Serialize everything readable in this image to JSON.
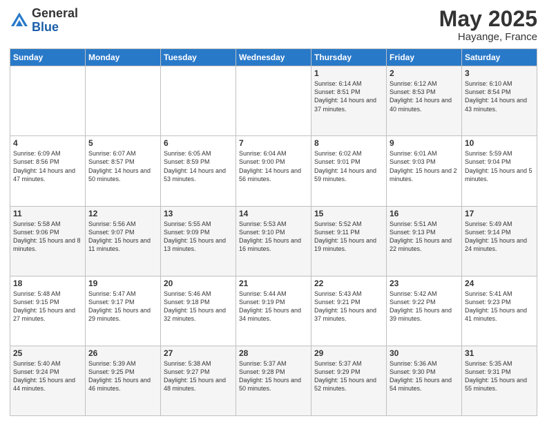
{
  "header": {
    "logo_general": "General",
    "logo_blue": "Blue",
    "month": "May 2025",
    "location": "Hayange, France"
  },
  "weekdays": [
    "Sunday",
    "Monday",
    "Tuesday",
    "Wednesday",
    "Thursday",
    "Friday",
    "Saturday"
  ],
  "weeks": [
    [
      {
        "day": "",
        "sunrise": "",
        "sunset": "",
        "daylight": ""
      },
      {
        "day": "",
        "sunrise": "",
        "sunset": "",
        "daylight": ""
      },
      {
        "day": "",
        "sunrise": "",
        "sunset": "",
        "daylight": ""
      },
      {
        "day": "",
        "sunrise": "",
        "sunset": "",
        "daylight": ""
      },
      {
        "day": "1",
        "sunrise": "Sunrise: 6:14 AM",
        "sunset": "Sunset: 8:51 PM",
        "daylight": "Daylight: 14 hours and 37 minutes."
      },
      {
        "day": "2",
        "sunrise": "Sunrise: 6:12 AM",
        "sunset": "Sunset: 8:53 PM",
        "daylight": "Daylight: 14 hours and 40 minutes."
      },
      {
        "day": "3",
        "sunrise": "Sunrise: 6:10 AM",
        "sunset": "Sunset: 8:54 PM",
        "daylight": "Daylight: 14 hours and 43 minutes."
      }
    ],
    [
      {
        "day": "4",
        "sunrise": "Sunrise: 6:09 AM",
        "sunset": "Sunset: 8:56 PM",
        "daylight": "Daylight: 14 hours and 47 minutes."
      },
      {
        "day": "5",
        "sunrise": "Sunrise: 6:07 AM",
        "sunset": "Sunset: 8:57 PM",
        "daylight": "Daylight: 14 hours and 50 minutes."
      },
      {
        "day": "6",
        "sunrise": "Sunrise: 6:05 AM",
        "sunset": "Sunset: 8:59 PM",
        "daylight": "Daylight: 14 hours and 53 minutes."
      },
      {
        "day": "7",
        "sunrise": "Sunrise: 6:04 AM",
        "sunset": "Sunset: 9:00 PM",
        "daylight": "Daylight: 14 hours and 56 minutes."
      },
      {
        "day": "8",
        "sunrise": "Sunrise: 6:02 AM",
        "sunset": "Sunset: 9:01 PM",
        "daylight": "Daylight: 14 hours and 59 minutes."
      },
      {
        "day": "9",
        "sunrise": "Sunrise: 6:01 AM",
        "sunset": "Sunset: 9:03 PM",
        "daylight": "Daylight: 15 hours and 2 minutes."
      },
      {
        "day": "10",
        "sunrise": "Sunrise: 5:59 AM",
        "sunset": "Sunset: 9:04 PM",
        "daylight": "Daylight: 15 hours and 5 minutes."
      }
    ],
    [
      {
        "day": "11",
        "sunrise": "Sunrise: 5:58 AM",
        "sunset": "Sunset: 9:06 PM",
        "daylight": "Daylight: 15 hours and 8 minutes."
      },
      {
        "day": "12",
        "sunrise": "Sunrise: 5:56 AM",
        "sunset": "Sunset: 9:07 PM",
        "daylight": "Daylight: 15 hours and 11 minutes."
      },
      {
        "day": "13",
        "sunrise": "Sunrise: 5:55 AM",
        "sunset": "Sunset: 9:09 PM",
        "daylight": "Daylight: 15 hours and 13 minutes."
      },
      {
        "day": "14",
        "sunrise": "Sunrise: 5:53 AM",
        "sunset": "Sunset: 9:10 PM",
        "daylight": "Daylight: 15 hours and 16 minutes."
      },
      {
        "day": "15",
        "sunrise": "Sunrise: 5:52 AM",
        "sunset": "Sunset: 9:11 PM",
        "daylight": "Daylight: 15 hours and 19 minutes."
      },
      {
        "day": "16",
        "sunrise": "Sunrise: 5:51 AM",
        "sunset": "Sunset: 9:13 PM",
        "daylight": "Daylight: 15 hours and 22 minutes."
      },
      {
        "day": "17",
        "sunrise": "Sunrise: 5:49 AM",
        "sunset": "Sunset: 9:14 PM",
        "daylight": "Daylight: 15 hours and 24 minutes."
      }
    ],
    [
      {
        "day": "18",
        "sunrise": "Sunrise: 5:48 AM",
        "sunset": "Sunset: 9:15 PM",
        "daylight": "Daylight: 15 hours and 27 minutes."
      },
      {
        "day": "19",
        "sunrise": "Sunrise: 5:47 AM",
        "sunset": "Sunset: 9:17 PM",
        "daylight": "Daylight: 15 hours and 29 minutes."
      },
      {
        "day": "20",
        "sunrise": "Sunrise: 5:46 AM",
        "sunset": "Sunset: 9:18 PM",
        "daylight": "Daylight: 15 hours and 32 minutes."
      },
      {
        "day": "21",
        "sunrise": "Sunrise: 5:44 AM",
        "sunset": "Sunset: 9:19 PM",
        "daylight": "Daylight: 15 hours and 34 minutes."
      },
      {
        "day": "22",
        "sunrise": "Sunrise: 5:43 AM",
        "sunset": "Sunset: 9:21 PM",
        "daylight": "Daylight: 15 hours and 37 minutes."
      },
      {
        "day": "23",
        "sunrise": "Sunrise: 5:42 AM",
        "sunset": "Sunset: 9:22 PM",
        "daylight": "Daylight: 15 hours and 39 minutes."
      },
      {
        "day": "24",
        "sunrise": "Sunrise: 5:41 AM",
        "sunset": "Sunset: 9:23 PM",
        "daylight": "Daylight: 15 hours and 41 minutes."
      }
    ],
    [
      {
        "day": "25",
        "sunrise": "Sunrise: 5:40 AM",
        "sunset": "Sunset: 9:24 PM",
        "daylight": "Daylight: 15 hours and 44 minutes."
      },
      {
        "day": "26",
        "sunrise": "Sunrise: 5:39 AM",
        "sunset": "Sunset: 9:25 PM",
        "daylight": "Daylight: 15 hours and 46 minutes."
      },
      {
        "day": "27",
        "sunrise": "Sunrise: 5:38 AM",
        "sunset": "Sunset: 9:27 PM",
        "daylight": "Daylight: 15 hours and 48 minutes."
      },
      {
        "day": "28",
        "sunrise": "Sunrise: 5:37 AM",
        "sunset": "Sunset: 9:28 PM",
        "daylight": "Daylight: 15 hours and 50 minutes."
      },
      {
        "day": "29",
        "sunrise": "Sunrise: 5:37 AM",
        "sunset": "Sunset: 9:29 PM",
        "daylight": "Daylight: 15 hours and 52 minutes."
      },
      {
        "day": "30",
        "sunrise": "Sunrise: 5:36 AM",
        "sunset": "Sunset: 9:30 PM",
        "daylight": "Daylight: 15 hours and 54 minutes."
      },
      {
        "day": "31",
        "sunrise": "Sunrise: 5:35 AM",
        "sunset": "Sunset: 9:31 PM",
        "daylight": "Daylight: 15 hours and 55 minutes."
      }
    ]
  ]
}
